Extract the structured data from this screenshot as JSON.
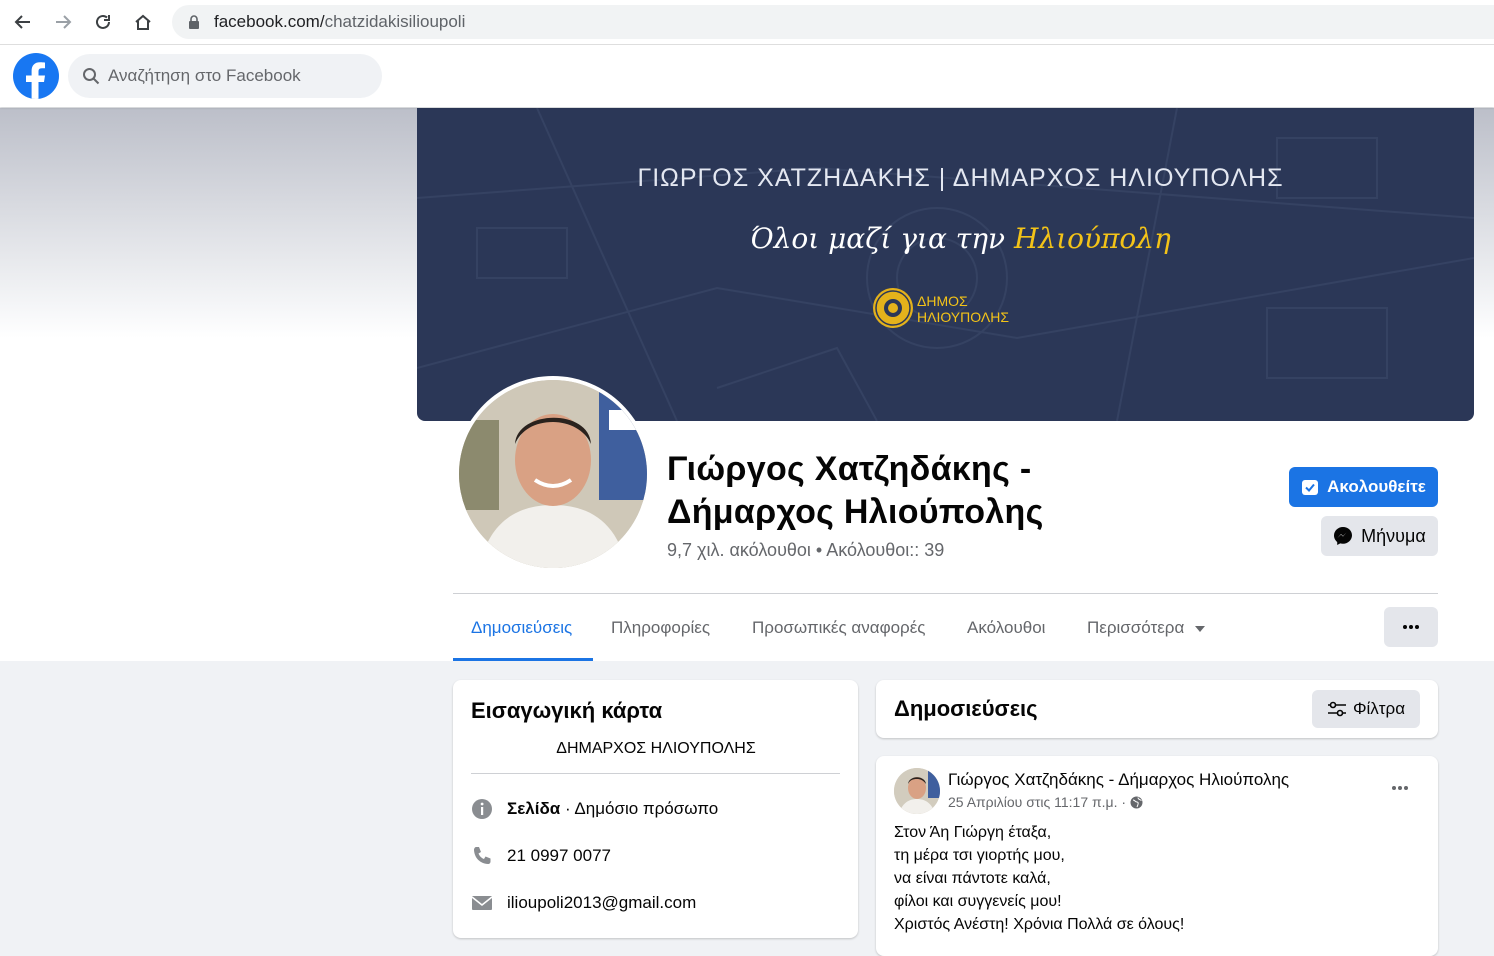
{
  "browser": {
    "url_host": "facebook.com/",
    "url_path": "chatzidakisilioupoli"
  },
  "header": {
    "search_placeholder": "Αναζήτηση στο Facebook"
  },
  "cover": {
    "title": "ΓΙΩΡΓΟΣ ΧΑΤΖΗΔΑΚΗΣ | ΔΗΜΑΡΧΟΣ ΗΛΙΟΥΠΟΛΗΣ",
    "slogan_prefix": "Όλοι μαζί για την ",
    "slogan_highlight": "Ηλιούπολη",
    "seal_line1": "ΔΗΜΟΣ",
    "seal_line2": "ΗΛΙΟΥΠΟΛΗΣ"
  },
  "profile": {
    "name_line1": "Γιώργος Χατζηδάκης -",
    "name_line2": "Δήμαρχος Ηλιούπολης",
    "stats": "9,7 χιλ. ακόλουθοι • Ακόλουθοι:: 39",
    "follow_label": "Ακολουθείτε",
    "message_label": "Μήνυμα"
  },
  "tabs": [
    {
      "label": "Δημοσιεύσεις"
    },
    {
      "label": "Πληροφορίες"
    },
    {
      "label": "Προσωπικές αναφορές"
    },
    {
      "label": "Ακόλουθοι"
    },
    {
      "label": "Περισσότερα"
    }
  ],
  "intro": {
    "title": "Εισαγωγική κάρτα",
    "bio": "ΔΗΜΑΡΧΟΣ ΗΛΙΟΥΠΟΛΗΣ",
    "category_bold": "Σελίδα",
    "category_rest": " · Δημόσιο πρόσωπο",
    "phone": "21 0997 0077",
    "email": "ilioupoli2013@gmail.com"
  },
  "posts_section": {
    "title": "Δημοσιεύσεις",
    "filters_label": "Φίλτρα"
  },
  "post": {
    "author": "Γιώργος Χατζηδάκης - Δήμαρχος Ηλιούπολης",
    "date": "25 Απριλίου στις 11:17 π.μ. ·",
    "lines": [
      "Στον Άη Γιώργη έταξα,",
      "τη μέρα τσι γιορτής μου,",
      "να είναι πάντοτε καλά,",
      "φίλοι και συγγενείς μου!",
      "Χριστός Ανέστη! Χρόνια Πολλά σε όλους!"
    ]
  },
  "colors": {
    "accent": "#1b74e4",
    "cover_bg": "#2b3757",
    "highlight": "#f3c318"
  }
}
